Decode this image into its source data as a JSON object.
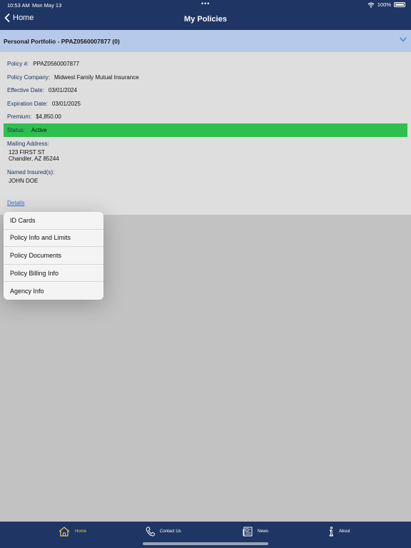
{
  "status_bar": {
    "time": "10:53 AM",
    "date": "Mon May 13",
    "dots": "•••",
    "battery": "100%"
  },
  "nav": {
    "back_label": "Home",
    "title": "My Policies"
  },
  "portfolio": {
    "label": "Personal Portfolio - PPAZ0560007877 (0)"
  },
  "policy": {
    "number_label": "Policy #:",
    "number": "PPAZ0560007877",
    "company_label": "Policy Company:",
    "company": "Midwest Family Mutual Insurance",
    "effective_label": "Effective Date:",
    "effective": "03/01/2024",
    "expiration_label": "Expiration Date:",
    "expiration": "03/01/2025",
    "premium_label": "Premium:",
    "premium": "$4,850.00",
    "status_label": "Status:",
    "status": "Active",
    "mailing_label": "Mailing Address:",
    "address_line1": "123 FIRST ST",
    "address_line2": "Chandler, AZ 85244",
    "insured_label": "Named Insured(s):",
    "insured": "JOHN DOE",
    "details_link": "Details"
  },
  "menu": {
    "items": [
      {
        "label": "ID Cards"
      },
      {
        "label": "Policy Info and Limits"
      },
      {
        "label": "Policy Documents"
      },
      {
        "label": "Policy Billing Info"
      },
      {
        "label": "Agency Info"
      }
    ]
  },
  "tabs": [
    {
      "label": "Home",
      "icon": "home-icon"
    },
    {
      "label": "Contact Us",
      "icon": "phone-icon"
    },
    {
      "label": "News",
      "icon": "newspaper-icon"
    },
    {
      "label": "About",
      "icon": "info-icon"
    }
  ],
  "colors": {
    "navy": "#1f3564",
    "portfolio_bar": "#b7c9e8",
    "status_green": "#2fbf4f",
    "active_tab": "#f0c74e",
    "link": "#2f6fd0"
  }
}
